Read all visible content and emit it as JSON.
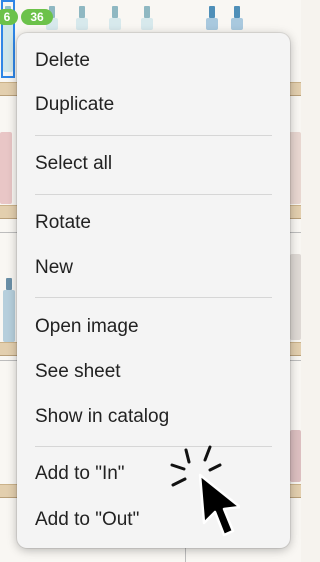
{
  "badges": {
    "left": "6",
    "right": "36"
  },
  "menu": {
    "items": [
      {
        "label": "Delete"
      },
      {
        "label": "Duplicate"
      },
      {
        "label": "Select all"
      },
      {
        "label": "Rotate"
      },
      {
        "label": "New"
      },
      {
        "label": "Open image"
      },
      {
        "label": "See sheet"
      },
      {
        "label": "Show in catalog"
      },
      {
        "label": "Add to \"In\""
      },
      {
        "label": "Add to \"Out\""
      }
    ]
  },
  "icons": {
    "pointer": "arrow-pointer-icon",
    "click_burst": "click-burst-icon"
  },
  "colors": {
    "selection": "#2f86e6",
    "badge": "#6cc24a",
    "menu_bg": "#f4f4f4",
    "shelf_wood": "#e3cfae"
  }
}
